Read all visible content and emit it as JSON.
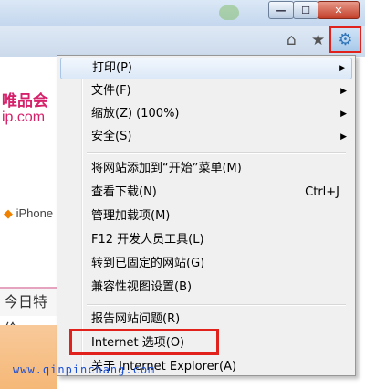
{
  "window": {
    "minimize_glyph": "—",
    "maximize_glyph": "☐",
    "close_glyph": "✕"
  },
  "toolbar": {
    "home_icon": "home-icon",
    "favorites_icon": "star-icon",
    "tools_icon": "gear-icon",
    "home_glyph": "⌂",
    "star_glyph": "★",
    "gear_glyph": "⚙"
  },
  "page": {
    "logo_line1": "唯品会",
    "logo_line2": "ip.com",
    "link_iphone": "iPhone",
    "today_tab": "今日特价"
  },
  "menu": {
    "items": [
      {
        "label": "打印(P)",
        "submenu": true
      },
      {
        "label": "文件(F)",
        "submenu": true
      },
      {
        "label": "缩放(Z) (100%)",
        "submenu": true
      },
      {
        "label": "安全(S)",
        "submenu": true
      },
      {
        "label": "将网站添加到“开始”菜单(M)"
      },
      {
        "label": "查看下载(N)",
        "shortcut": "Ctrl+J"
      },
      {
        "label": "管理加载项(M)"
      },
      {
        "label": "F12 开发人员工具(L)"
      },
      {
        "label": "转到已固定的网站(G)"
      },
      {
        "label": "兼容性视图设置(B)"
      },
      {
        "label": "报告网站问题(R)"
      },
      {
        "label": "Internet 选项(O)"
      },
      {
        "label": "关于 Internet Explorer(A)"
      }
    ],
    "submenu_arrow": "▶"
  },
  "watermark": "www.qinpinchang.com",
  "colors": {
    "highlight_border": "#e0211c",
    "logo": "#d6226b",
    "watermark": "#1a4fd6"
  }
}
